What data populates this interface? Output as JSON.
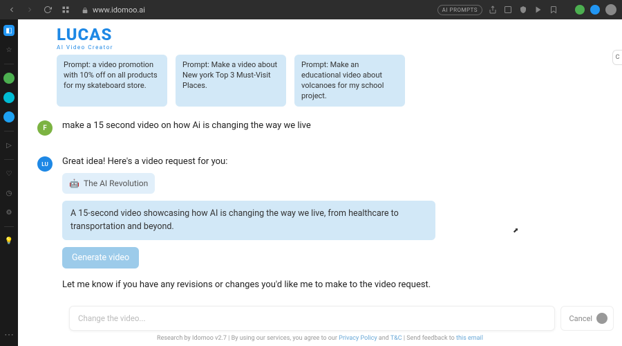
{
  "browser": {
    "url": "www.idomoo.ai",
    "pill": "AI PROMPTS"
  },
  "logo": {
    "text": "LUCAS",
    "sub": "AI Video Creator"
  },
  "chips": [
    "Prompt: a video promotion with 10% off on all products for my skateboard store.",
    "Prompt: Make a video about New york Top 3 Must-Visit Places.",
    "Prompt: Make an educational video about volcanoes for my school project."
  ],
  "cut_chip": "C",
  "user_avatar": "F",
  "bot_avatar": "LU",
  "user_msg": "make a 15 second video on how Ai is changing the way we live",
  "bot_intro": "Great idea! Here's a video request for you:",
  "video_title": "The AI Revolution",
  "video_desc": "A 15-second video showcasing how AI is changing the way we live, from healthcare to transportation and beyond.",
  "generate": "Generate video",
  "bot_outro": "Let me know if you have any revisions or changes you'd like me to make to the video request.",
  "input_placeholder": "Change the video...",
  "cancel": "Cancel",
  "legal": {
    "prefix": "Research by Idomoo v2.7 | By using our services, you agree to our ",
    "privacy": "Privacy Policy",
    "mid": " and ",
    "tnc": "T&C",
    "sep": " | Send feedback to ",
    "email": "this email"
  }
}
